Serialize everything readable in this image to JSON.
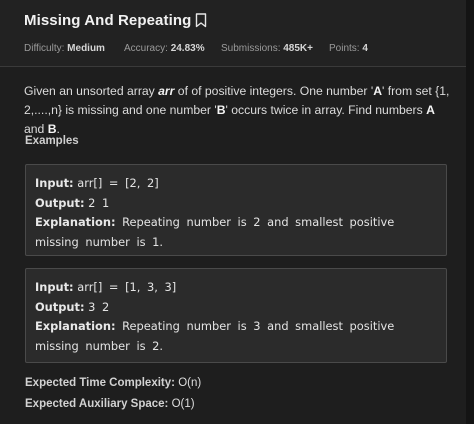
{
  "problem": {
    "title": "Missing And Repeating",
    "meta": [
      {
        "label": "Difficulty:",
        "value": "Medium"
      },
      {
        "label": "Accuracy:",
        "value": "24.83%"
      },
      {
        "label": "Submissions:",
        "value": "485K+"
      },
      {
        "label": "Points:",
        "value": "4"
      }
    ]
  },
  "description": {
    "part1": "Given an unsorted array ",
    "arr": "arr",
    "part2": " of of positive integers. One number '",
    "a": "A",
    "part3": "' from set {1, 2,....,n} is missing and one number '",
    "b": "B",
    "part4": "' occurs twice in array. Find numbers ",
    "answer_a": "A",
    "and": " and ",
    "answer_b": "B",
    "end": "."
  },
  "examples_heading": "Examples",
  "examples": [
    {
      "input_label": "Input:",
      "input": "arr[] = [2, 2]",
      "output_label": "Output:",
      "output": "2 1",
      "explanation_label": "Explanation:",
      "explanation": "Repeating number is 2 and smallest positive missing number is 1."
    },
    {
      "input_label": "Input:",
      "input": "arr[] = [1, 3, 3]",
      "output_label": "Output:",
      "output": "3 2",
      "explanation_label": "Explanation:",
      "explanation": "Repeating number is 3 and smallest positive missing number is 2."
    }
  ],
  "complexity": {
    "time_label": "Expected Time Complexity:",
    "time_value": "O(n)",
    "space_label": "Expected Auxiliary Space:",
    "space_value": "O(1)"
  },
  "icons": {
    "bookmark": "bookmark-icon"
  },
  "colors": {
    "background": "#1e1e1e",
    "example_box": "#2b2b2b",
    "text": "#e8e8e8"
  }
}
